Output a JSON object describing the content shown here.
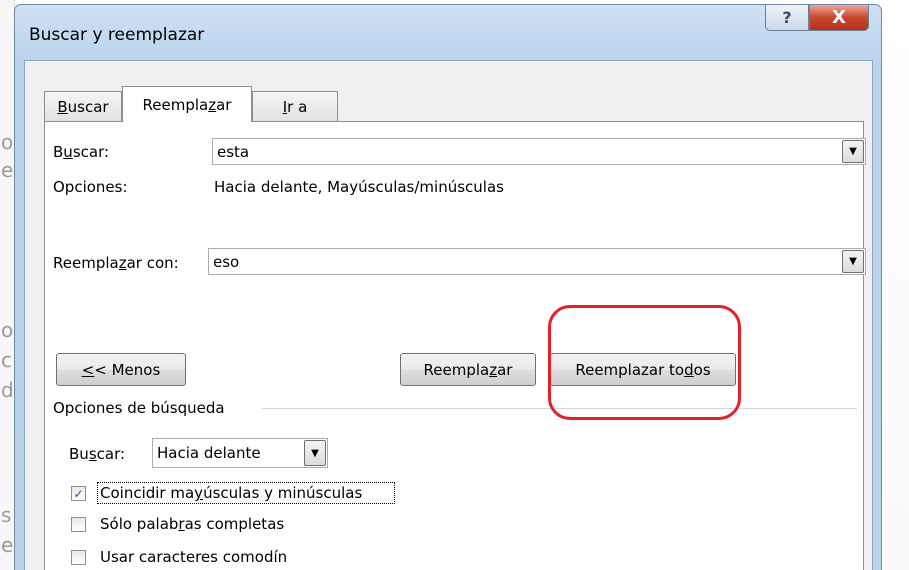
{
  "dialog": {
    "title": "Buscar y reemplazar",
    "help_glyph": "?",
    "close_glyph": "X"
  },
  "tabs": [
    {
      "pre": "",
      "u": "B",
      "post": "uscar"
    },
    {
      "pre": "Reempla",
      "u": "z",
      "post": "ar"
    },
    {
      "pre": "",
      "u": "I",
      "post": "r a"
    }
  ],
  "find": {
    "label_pre": "B",
    "label_u": "u",
    "label_post": "scar:",
    "value": "esta"
  },
  "options_label": "Opciones:",
  "options_value": "Hacia delante, Mayúsculas/minúsculas",
  "replace": {
    "label_pre": "Reempla",
    "label_u": "z",
    "label_post": "ar con:",
    "value": "eso"
  },
  "buttons": {
    "less_u": "<",
    "less_rest": "< Menos",
    "replace_pre": "Reempla",
    "replace_u": "z",
    "replace_post": "ar",
    "replace_all_pre": "Reemplazar to",
    "replace_all_u": "d",
    "replace_all_post": "os"
  },
  "search_options": {
    "title": "Opciones de búsqueda",
    "direction_label_pre": "Bu",
    "direction_label_u": "s",
    "direction_label_post": "car:",
    "direction_value": "Hacia delante",
    "checkboxes": [
      {
        "checked": true,
        "check_glyph": "✓",
        "pre": "Coincidir ma",
        "u": "y",
        "post": "úsculas y minúsculas"
      },
      {
        "checked": false,
        "check_glyph": "",
        "pre": "Sólo palab",
        "u": "r",
        "post": "as completas"
      },
      {
        "checked": false,
        "check_glyph": "",
        "pre": "Usar caracteres comodín",
        "u": "",
        "post": ""
      }
    ]
  },
  "colors": {
    "highlight": "#e32026",
    "titlebar": "#bad3ec",
    "close_button": "#c9462d"
  },
  "icons": {
    "dropdown": "triangle-down",
    "checkmark": "check"
  }
}
